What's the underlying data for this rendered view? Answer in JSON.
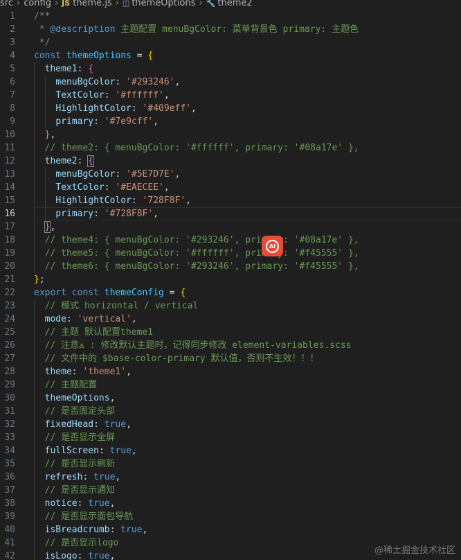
{
  "breadcrumb": {
    "items": [
      "src",
      "config",
      "theme.js",
      "themeOptions",
      "theme2"
    ],
    "file_badge": "JS"
  },
  "editor": {
    "current_line": 16,
    "lines": [
      {
        "n": "1",
        "tokens": [
          [
            "c",
            "/**"
          ]
        ]
      },
      {
        "n": "2",
        "tokens": [
          [
            "c",
            " * "
          ],
          [
            "doc",
            "@description"
          ],
          [
            "c",
            " 主题配置 menuBgColor: 菜单背景色 primary: 主题色"
          ]
        ]
      },
      {
        "n": "3",
        "tokens": [
          [
            "c",
            " */"
          ]
        ]
      },
      {
        "n": "4",
        "tokens": [
          [
            "k",
            "const"
          ],
          [
            "p",
            " "
          ],
          [
            "v",
            "themeOptions"
          ],
          [
            "p",
            " = "
          ],
          [
            "b1",
            "{"
          ]
        ]
      },
      {
        "n": "5",
        "tokens": [
          [
            "p",
            "  "
          ],
          [
            "pr",
            "theme1"
          ],
          [
            "p",
            ": "
          ],
          [
            "b2",
            "{"
          ]
        ]
      },
      {
        "n": "6",
        "tokens": [
          [
            "p",
            "    "
          ],
          [
            "pr",
            "menuBgColor"
          ],
          [
            "p",
            ": "
          ],
          [
            "s",
            "'#293246'"
          ],
          [
            "p",
            ","
          ]
        ]
      },
      {
        "n": "7",
        "tokens": [
          [
            "p",
            "    "
          ],
          [
            "pr",
            "TextColor"
          ],
          [
            "p",
            ": "
          ],
          [
            "s",
            "'#ffffff'"
          ],
          [
            "p",
            ","
          ]
        ]
      },
      {
        "n": "8",
        "tokens": [
          [
            "p",
            "    "
          ],
          [
            "pr",
            "HighlightColor"
          ],
          [
            "p",
            ": "
          ],
          [
            "s",
            "'#409eff'"
          ],
          [
            "p",
            ","
          ]
        ]
      },
      {
        "n": "9",
        "tokens": [
          [
            "p",
            "    "
          ],
          [
            "pr",
            "primary"
          ],
          [
            "p",
            ": "
          ],
          [
            "s",
            "'#7e9cff'"
          ],
          [
            "p",
            ","
          ]
        ]
      },
      {
        "n": "10",
        "tokens": [
          [
            "p",
            "  "
          ],
          [
            "b2",
            "}"
          ],
          [
            "p",
            ","
          ]
        ]
      },
      {
        "n": "11",
        "tokens": [
          [
            "p",
            "  "
          ],
          [
            "c",
            "// theme2: { menuBgColor: '#ffffff', primary: '#08a17e' },"
          ]
        ]
      },
      {
        "n": "12",
        "tokens": [
          [
            "p",
            "  "
          ],
          [
            "pr",
            "theme2"
          ],
          [
            "p",
            ": "
          ],
          [
            "b2x",
            "{"
          ]
        ]
      },
      {
        "n": "13",
        "tokens": [
          [
            "p",
            "    "
          ],
          [
            "pr",
            "menuBgColor"
          ],
          [
            "p",
            ": "
          ],
          [
            "s",
            "'#5E7D7E'"
          ],
          [
            "p",
            ","
          ]
        ]
      },
      {
        "n": "14",
        "tokens": [
          [
            "p",
            "    "
          ],
          [
            "pr",
            "TextColor"
          ],
          [
            "p",
            ": "
          ],
          [
            "s",
            "'#EAECEE'"
          ],
          [
            "p",
            ","
          ]
        ]
      },
      {
        "n": "15",
        "tokens": [
          [
            "p",
            "    "
          ],
          [
            "pr",
            "HighlightColor"
          ],
          [
            "p",
            ": "
          ],
          [
            "s",
            "'728F8F'"
          ],
          [
            "p",
            ","
          ]
        ]
      },
      {
        "n": "16",
        "tokens": [
          [
            "p",
            "    "
          ],
          [
            "pr",
            "primary"
          ],
          [
            "p",
            ": "
          ],
          [
            "s",
            "'#728F8F'"
          ],
          [
            "p",
            ","
          ]
        ]
      },
      {
        "n": "17",
        "tokens": [
          [
            "p",
            "  "
          ],
          [
            "b2x",
            "}"
          ],
          [
            "p",
            ","
          ]
        ]
      },
      {
        "n": "18",
        "tokens": [
          [
            "p",
            "  "
          ],
          [
            "c",
            "// theme4: { menuBgColor: '#293246', primary: '#08a17e' },"
          ]
        ]
      },
      {
        "n": "19",
        "tokens": [
          [
            "p",
            "  "
          ],
          [
            "c",
            "// theme5: { menuBgColor: '#ffffff', primary: '#f45555' },"
          ]
        ]
      },
      {
        "n": "20",
        "tokens": [
          [
            "p",
            "  "
          ],
          [
            "c",
            "// theme6: { menuBgColor: '#293246', primary: '#f45555' },"
          ]
        ]
      },
      {
        "n": "21",
        "tokens": [
          [
            "b1",
            "}"
          ],
          [
            "p",
            ";"
          ]
        ]
      },
      {
        "n": "22",
        "tokens": [
          [
            "k",
            "export"
          ],
          [
            "p",
            " "
          ],
          [
            "k",
            "const"
          ],
          [
            "p",
            " "
          ],
          [
            "v",
            "themeConfig"
          ],
          [
            "p",
            " = "
          ],
          [
            "b1",
            "{"
          ]
        ]
      },
      {
        "n": "23",
        "tokens": [
          [
            "p",
            "  "
          ],
          [
            "c",
            "// 模式 horizontal / vertical"
          ]
        ]
      },
      {
        "n": "24",
        "tokens": [
          [
            "p",
            "  "
          ],
          [
            "pr",
            "mode"
          ],
          [
            "p",
            ": "
          ],
          [
            "s",
            "'vertical'"
          ],
          [
            "p",
            ","
          ]
        ]
      },
      {
        "n": "25",
        "tokens": [
          [
            "p",
            "  "
          ],
          [
            "c",
            "// 主题 默认配置theme1"
          ]
        ]
      },
      {
        "n": "26",
        "tokens": [
          [
            "p",
            "  "
          ],
          [
            "c",
            "// 注意"
          ],
          [
            "w",
            "⚠"
          ],
          [
            "c",
            " : 修改默认主题时，记得同步修改 element-variables.scss"
          ]
        ]
      },
      {
        "n": "27",
        "tokens": [
          [
            "p",
            "  "
          ],
          [
            "c",
            "// 文件中的 $base-color-primary 默认值，否则不生效！！！"
          ]
        ]
      },
      {
        "n": "28",
        "tokens": [
          [
            "p",
            "  "
          ],
          [
            "pr",
            "theme"
          ],
          [
            "p",
            ": "
          ],
          [
            "s",
            "'theme1'"
          ],
          [
            "p",
            ","
          ]
        ]
      },
      {
        "n": "29",
        "tokens": [
          [
            "p",
            "  "
          ],
          [
            "c",
            "// 主题配置"
          ]
        ]
      },
      {
        "n": "30",
        "tokens": [
          [
            "p",
            "  "
          ],
          [
            "pr",
            "themeOptions"
          ],
          [
            "p",
            ","
          ]
        ]
      },
      {
        "n": "31",
        "tokens": [
          [
            "p",
            "  "
          ],
          [
            "c",
            "// 是否固定头部"
          ]
        ]
      },
      {
        "n": "32",
        "tokens": [
          [
            "p",
            "  "
          ],
          [
            "pr",
            "fixedHead"
          ],
          [
            "p",
            ": "
          ],
          [
            "bo",
            "true"
          ],
          [
            "p",
            ","
          ]
        ]
      },
      {
        "n": "33",
        "tokens": [
          [
            "p",
            "  "
          ],
          [
            "c",
            "// 是否显示全屏"
          ]
        ]
      },
      {
        "n": "34",
        "tokens": [
          [
            "p",
            "  "
          ],
          [
            "pr",
            "fullScreen"
          ],
          [
            "p",
            ": "
          ],
          [
            "bo",
            "true"
          ],
          [
            "p",
            ","
          ]
        ]
      },
      {
        "n": "35",
        "tokens": [
          [
            "p",
            "  "
          ],
          [
            "c",
            "// 是否显示刷新"
          ]
        ]
      },
      {
        "n": "36",
        "tokens": [
          [
            "p",
            "  "
          ],
          [
            "pr",
            "refresh"
          ],
          [
            "p",
            ": "
          ],
          [
            "bo",
            "true"
          ],
          [
            "p",
            ","
          ]
        ]
      },
      {
        "n": "37",
        "tokens": [
          [
            "p",
            "  "
          ],
          [
            "c",
            "// 是否显示通知"
          ]
        ]
      },
      {
        "n": "38",
        "tokens": [
          [
            "p",
            "  "
          ],
          [
            "pr",
            "notice"
          ],
          [
            "p",
            ": "
          ],
          [
            "bo",
            "true"
          ],
          [
            "p",
            ","
          ]
        ]
      },
      {
        "n": "39",
        "tokens": [
          [
            "p",
            "  "
          ],
          [
            "c",
            "// 是否显示面包导航"
          ]
        ]
      },
      {
        "n": "40",
        "tokens": [
          [
            "p",
            "  "
          ],
          [
            "pr",
            "isBreadcrumb"
          ],
          [
            "p",
            ": "
          ],
          [
            "bo",
            "true"
          ],
          [
            "p",
            ","
          ]
        ]
      },
      {
        "n": "41",
        "tokens": [
          [
            "p",
            "  "
          ],
          [
            "c",
            "// 是否显示logo"
          ]
        ]
      },
      {
        "n": "42",
        "tokens": [
          [
            "p",
            "  "
          ],
          [
            "pr",
            "isLogo"
          ],
          [
            "p",
            ": "
          ],
          [
            "bo",
            "true"
          ],
          [
            "p",
            ","
          ]
        ]
      }
    ]
  },
  "overlay": {
    "ai_badge_label": "AI"
  },
  "watermark": "@稀土掘金技术社区",
  "colors": {
    "background": "#1f1f1f",
    "comment": "#6a9955",
    "keyword": "#569cd6",
    "string": "#ce9178",
    "property": "#9cdcfe",
    "ai_badge": "#ea4b36"
  }
}
